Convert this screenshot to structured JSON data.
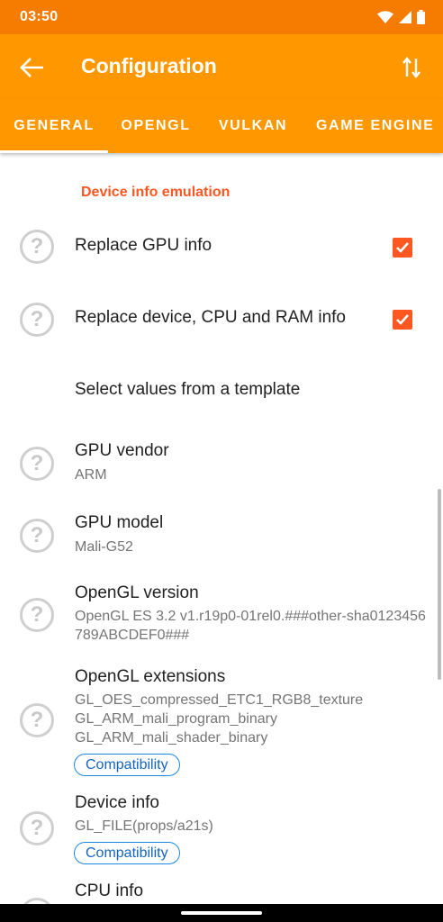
{
  "status_bar": {
    "time": "03:50",
    "icons": [
      "wifi-icon",
      "signal-icon",
      "battery-icon"
    ]
  },
  "app_bar": {
    "title": "Configuration",
    "back_icon": "arrow-back-icon",
    "action_icon": "swap-vert-icon"
  },
  "tabs": [
    {
      "label": "GENERAL",
      "selected": true
    },
    {
      "label": "OPENGL",
      "selected": false
    },
    {
      "label": "VULKAN",
      "selected": false
    },
    {
      "label": "GAME ENGINE",
      "selected": false
    }
  ],
  "section": {
    "header": "Device info emulation"
  },
  "help_icon": "?",
  "items": {
    "replace_gpu": {
      "title": "Replace GPU info",
      "checked": true
    },
    "replace_device": {
      "title": "Replace device, CPU and RAM info",
      "checked": true
    },
    "template": {
      "title": "Select values from a template"
    },
    "gpu_vendor": {
      "title": "GPU vendor",
      "value": "ARM"
    },
    "gpu_model": {
      "title": "GPU model",
      "value": "Mali-G52"
    },
    "opengl_version": {
      "title": "OpenGL version",
      "value": "OpenGL ES 3.2 v1.r19p0-01rel0.###other-sha0123456789ABCDEF0###"
    },
    "opengl_extensions": {
      "title": "OpenGL extensions",
      "lines": [
        "GL_OES_compressed_ETC1_RGB8_texture",
        "GL_ARM_mali_program_binary",
        "GL_ARM_mali_shader_binary"
      ],
      "badge": "Compatibility"
    },
    "device_info": {
      "title": "Device info",
      "value": "GL_FILE(props/a21s)",
      "badge": "Compatibility"
    },
    "cpu_info": {
      "title": "CPU info"
    }
  },
  "colors": {
    "status_bar": "#f57c00",
    "app_bar": "#ff9800",
    "accent": "#ff5722",
    "badge": "#1e88e5"
  }
}
